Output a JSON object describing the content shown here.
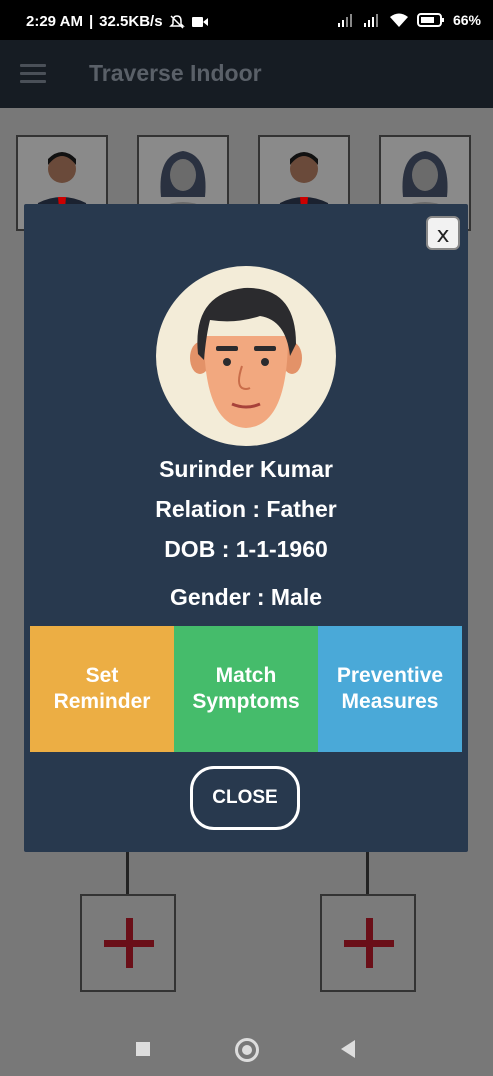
{
  "status_bar": {
    "time": "2:29 AM",
    "network_speed": "32.5KB/s",
    "battery_percent": "66%"
  },
  "app_bar": {
    "title": "Traverse Indoor"
  },
  "modal": {
    "close_icon_label": "x",
    "name": "Surinder Kumar",
    "relation": "Relation : Father",
    "dob": "DOB : 1-1-1960",
    "gender": "Gender : Male",
    "actions": [
      {
        "label_line1": "Set",
        "label_line2": "Reminder",
        "color": "#ecae44"
      },
      {
        "label_line1": "Match",
        "label_line2": "Symptoms",
        "color": "#45bc6b"
      },
      {
        "label_line1": "Preventive",
        "label_line2": "Measures",
        "color": "#4aa9d8"
      }
    ],
    "close_button": "CLOSE"
  },
  "colors": {
    "modal_bg": "#28394e",
    "app_bar_bg": "#161c23",
    "plus_red": "#6a0f18"
  }
}
